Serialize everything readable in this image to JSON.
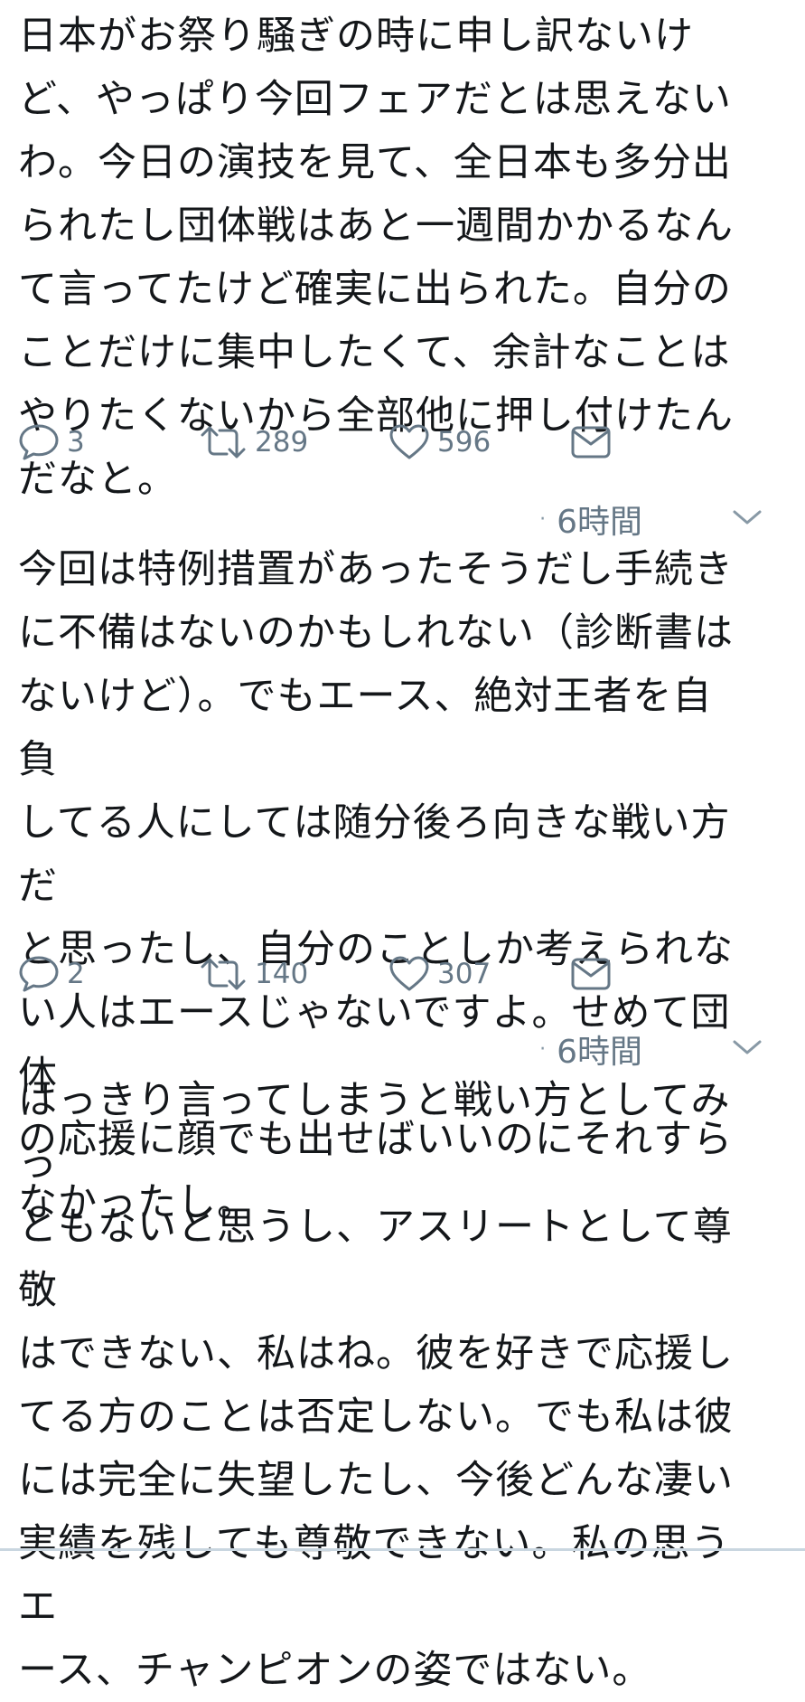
{
  "tweets": [
    {
      "time": "",
      "text": "日本がお祭り騒ぎの時に申し訳ないけ\nど、やっぱり今回フェアだとは思えない\nわ。今日の演技を見て、全日本も多分出\nられたし団体戦はあと一週間かかるなん\nて言ってたけど確実に出られた。自分の\nことだけに集中したくて、余計なことは\nやりたくないから全部他に押し付けたん\nだなと。",
      "replies": "3",
      "retweets": "289",
      "likes": "596"
    },
    {
      "time": "6時間",
      "text": "今回は特例措置があったそうだし手続き\nに不備はないのかもしれない（診断書は\nないけど）。でもエース、絶対王者を自負\nしてる人にしては随分後ろ向きな戦い方だ\nと思ったし、自分のことしか考えられな\nい人はエースじゃないですよ。せめて団体\nの応援に顔でも出せばいいのにそれすら\nなかったし。",
      "replies": "2",
      "retweets": "140",
      "likes": "307"
    },
    {
      "time": "6時間",
      "text": "はっきり言ってしまうと戦い方としてみっ\nともないと思うし、アスリートとして尊敬\nはできない、私はね。彼を好きで応援し\nてる方のことは否定しない。でも私は彼\nには完全に失望したし、今後どんな凄い\n実績を残しても尊敬できない。私の思うエ\nース、チャンピオンの姿ではない。"
    }
  ],
  "icons": {
    "reply": "reply-icon",
    "retweet": "retweet-icon",
    "like": "heart-icon",
    "dm": "envelope-icon",
    "more": "chevron-down-icon"
  },
  "colors": {
    "text": "#14171a",
    "secondary": "#657786"
  }
}
